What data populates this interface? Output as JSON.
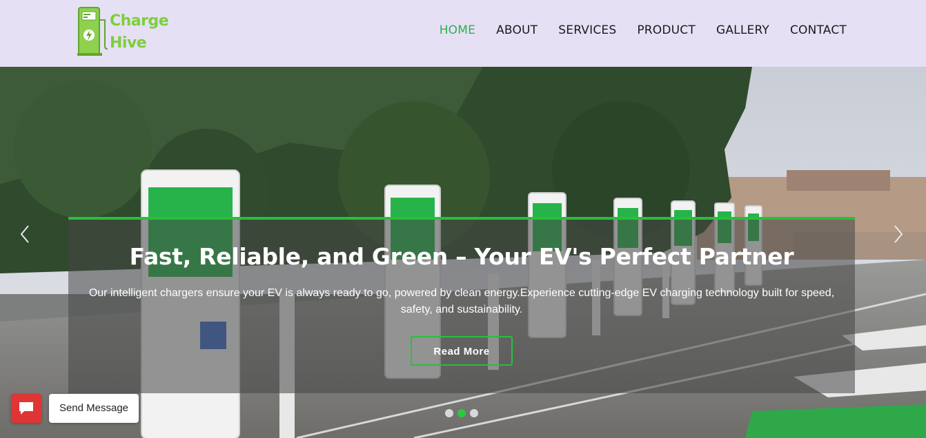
{
  "brand": {
    "line1": "Charge",
    "line2": "Hive",
    "logo_icon": "ev-charger-icon",
    "color": "#7ccf3a"
  },
  "nav": {
    "items": [
      {
        "label": "HOME",
        "active": true
      },
      {
        "label": "ABOUT",
        "active": false
      },
      {
        "label": "SERVICES",
        "active": false
      },
      {
        "label": "PRODUCT",
        "active": false
      },
      {
        "label": "GALLERY",
        "active": false
      },
      {
        "label": "CONTACT",
        "active": false
      }
    ],
    "active_color": "#2bb24c"
  },
  "hero": {
    "title": "Fast, Reliable, and Green – Your EV's Perfect Partner",
    "description": "Our intelligent chargers ensure your EV is always ready to go, powered by clean energy.Experience cutting-edge EV charging technology built for speed, safety, and sustainability.",
    "button_label": "Read More",
    "accent_color": "#27c03a",
    "prev_icon": "chevron-left-icon",
    "next_icon": "chevron-right-icon",
    "slides": 3,
    "active_slide": 2
  },
  "chat": {
    "icon": "message-icon",
    "label": "Send Message",
    "color": "#e03535"
  }
}
